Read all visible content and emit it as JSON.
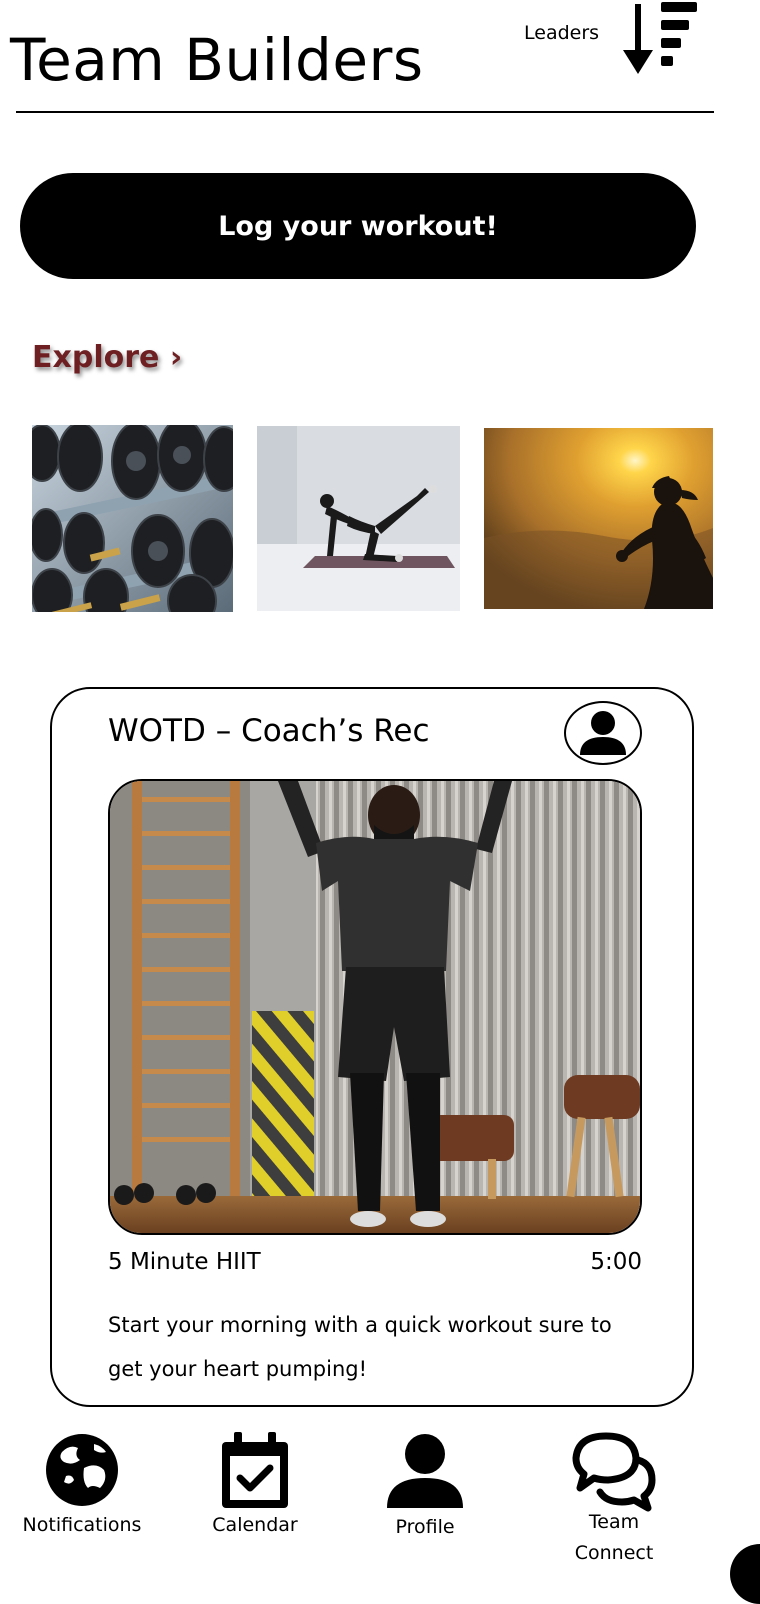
{
  "header": {
    "title": "Team Builders",
    "leaders_label": "Leaders",
    "leaders_icon": "sort-descending-icon"
  },
  "actions": {
    "log_workout_label": "Log your workout!"
  },
  "explore": {
    "label": "Explore",
    "chevron": "›",
    "accent_color": "#6e1f22",
    "thumbnails": [
      {
        "subject": "dumbbell-rack"
      },
      {
        "subject": "yoga-pose"
      },
      {
        "subject": "sunset-runner"
      }
    ]
  },
  "wotd": {
    "title": "WOTD – Coach’s Rec",
    "coach_icon": "user-icon",
    "workout_name": "5 Minute HIIT",
    "duration": "5:00",
    "description": "Start your morning with a quick workout sure to get your heart pumping!"
  },
  "bottom_nav": [
    {
      "label": "Notifications",
      "icon": "globe-icon"
    },
    {
      "label": "Calendar",
      "icon": "calendar-check-icon"
    },
    {
      "label": "Profile",
      "icon": "user-icon"
    },
    {
      "label_line1": "Team",
      "label_line2": "Connect",
      "icon": "chat-bubbles-icon"
    }
  ]
}
